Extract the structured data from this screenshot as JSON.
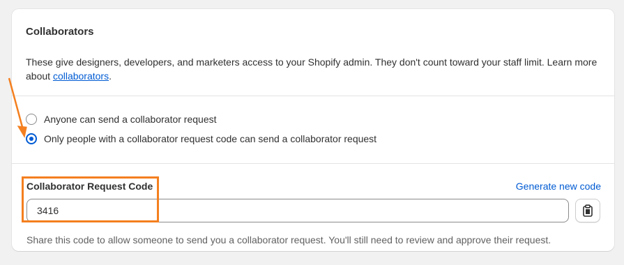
{
  "card": {
    "title": "Collaborators",
    "description_before_link": "These give designers, developers, and marketers access to your Shopify admin. They don't count toward your staff limit. Learn more about ",
    "description_link": "collaborators",
    "description_after_link": "."
  },
  "request_options": {
    "options": [
      {
        "label": "Anyone can send a collaborator request",
        "selected": false
      },
      {
        "label": "Only people with a collaborator request code can send a collaborator request",
        "selected": true
      }
    ]
  },
  "request_code": {
    "label": "Collaborator Request Code",
    "generate_link": "Generate new code",
    "value": "3416",
    "copy_icon": "clipboard-icon",
    "help_text": "Share this code to allow someone to send you a collaborator request. You'll still need to review and approve their request."
  },
  "annotations": {
    "color": "#f47f1f"
  },
  "colors": {
    "accent": "#005bd3",
    "annotation": "#f47f1f"
  }
}
